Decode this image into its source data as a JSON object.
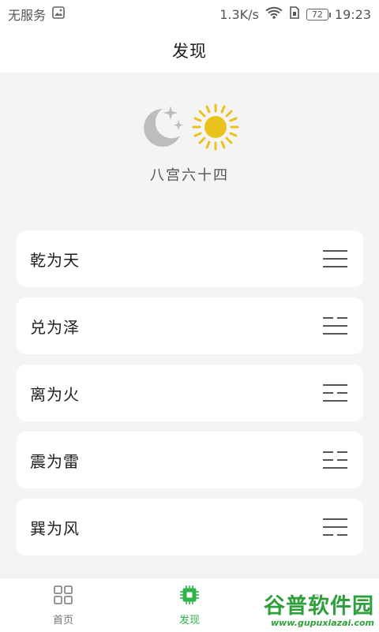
{
  "status_bar": {
    "carrier": "无服务",
    "speed": "1.3K/s",
    "battery": "72",
    "time": "19:23",
    "icons": [
      "image-notification-icon",
      "wifi-icon",
      "sim-icon",
      "battery-icon"
    ]
  },
  "header": {
    "title": "发现"
  },
  "hero": {
    "title": "八宫六十四",
    "icons": [
      "moon-stars-icon",
      "sun-icon"
    ],
    "moon_color": "#bdbdbd",
    "sun_color": "#e9c21e"
  },
  "list": {
    "items": [
      {
        "label": "乾为天",
        "trigram": [
          "solid",
          "solid",
          "solid"
        ]
      },
      {
        "label": "兑为泽",
        "trigram": [
          "broken",
          "solid",
          "solid"
        ]
      },
      {
        "label": "离为火",
        "trigram": [
          "solid",
          "broken",
          "solid"
        ]
      },
      {
        "label": "震为雷",
        "trigram": [
          "broken",
          "broken",
          "solid"
        ]
      },
      {
        "label": "巽为风",
        "trigram": [
          "solid",
          "solid",
          "broken"
        ]
      }
    ]
  },
  "bottom_nav": {
    "items": [
      {
        "label": "首页",
        "icon": "grid-icon",
        "active": false
      },
      {
        "label": "发现",
        "icon": "chip-icon",
        "active": true
      },
      {
        "label": "",
        "icon": "profile-icon",
        "active": false
      }
    ],
    "accent": "#2eb34a"
  },
  "watermark": {
    "text": "谷普软件园",
    "url": "www.gupuxiazai.com"
  }
}
